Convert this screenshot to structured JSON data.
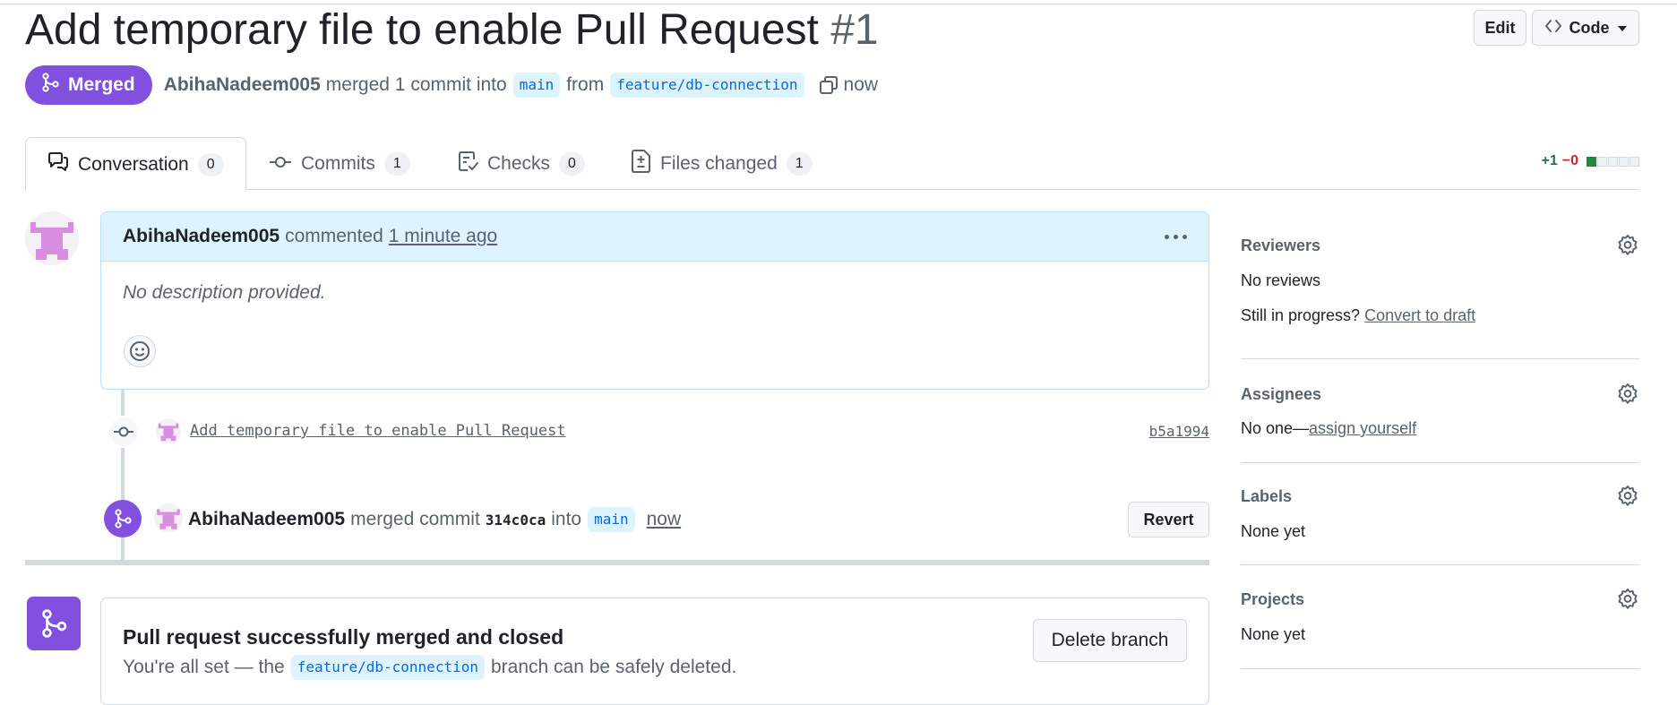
{
  "pr": {
    "title": "Add temporary file to enable Pull Request",
    "number": "#1",
    "state": "Merged",
    "author": "AbihaNadeem005",
    "merged_text": "merged 1 commit into",
    "base_branch": "main",
    "from_text": "from",
    "head_branch": "feature/db-connection",
    "time": "now"
  },
  "header_buttons": {
    "edit": "Edit",
    "code": "Code"
  },
  "tabs": [
    {
      "label": "Conversation",
      "count": "0",
      "icon": "comment-discussion-icon",
      "active": true
    },
    {
      "label": "Commits",
      "count": "1",
      "icon": "git-commit-icon"
    },
    {
      "label": "Checks",
      "count": "0",
      "icon": "checklist-icon"
    },
    {
      "label": "Files changed",
      "count": "1",
      "icon": "file-diff-icon"
    }
  ],
  "diffstat": {
    "additions": "+1",
    "deletions": "−0",
    "blocks_added": 1,
    "blocks_total": 5
  },
  "comment": {
    "author": "AbihaNadeem005",
    "action": "commented",
    "time": "1 minute ago",
    "body": "No description provided."
  },
  "commit": {
    "message": "Add temporary file to enable Pull Request",
    "sha": "b5a1994"
  },
  "merge_event": {
    "author": "AbihaNadeem005",
    "action": "merged commit",
    "sha": "314c0ca",
    "into": "into",
    "branch": "main",
    "time": "now",
    "revert_label": "Revert"
  },
  "merge_box": {
    "title": "Pull request successfully merged and closed",
    "sub_prefix": "You're all set — the",
    "branch": "feature/db-connection",
    "sub_suffix": "branch can be safely deleted.",
    "delete_label": "Delete branch"
  },
  "sidebar": {
    "reviewers": {
      "title": "Reviewers",
      "value": "No reviews",
      "draft_prefix": "Still in progress?",
      "draft_link": "Convert to draft"
    },
    "assignees": {
      "title": "Assignees",
      "value": "No one—",
      "link": "assign yourself"
    },
    "labels": {
      "title": "Labels",
      "value": "None yet"
    },
    "projects": {
      "title": "Projects",
      "value": "None yet"
    }
  },
  "colors": {
    "merged": "#8250df",
    "branch_bg": "#ddf4ff",
    "link_blue": "#0969da",
    "addition": "#1a7f37",
    "deletion": "#d1242f"
  }
}
